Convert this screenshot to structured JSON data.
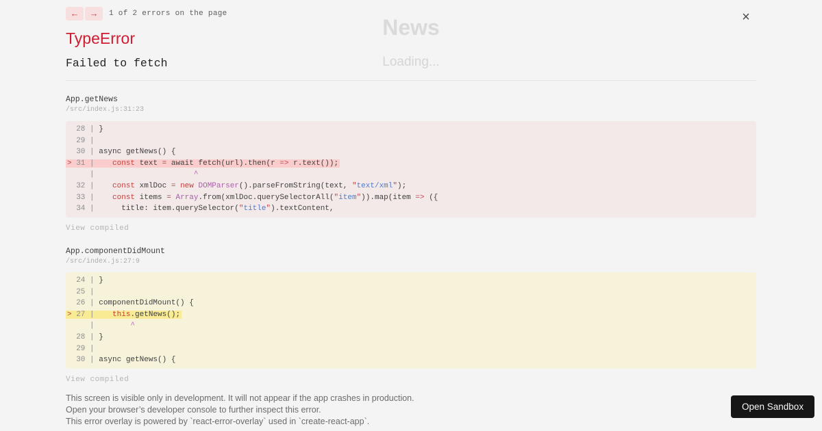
{
  "app_background": {
    "title": "News",
    "loading_text": "Loading..."
  },
  "nav": {
    "back_icon": "←",
    "forward_icon": "→",
    "counter": "1 of 2 errors on the page",
    "close_icon": "×"
  },
  "error": {
    "type": "TypeError",
    "message": "Failed to fetch"
  },
  "frames": [
    {
      "function": "App.getNews",
      "location": "/src/index.js:31:23",
      "variant": "error-pink",
      "view_compiled_label": "View compiled",
      "lines": [
        {
          "hl": false,
          "tokens": [
            [
              "g",
              "  28 | "
            ],
            [
              "p",
              "}"
            ]
          ]
        },
        {
          "hl": false,
          "tokens": [
            [
              "g",
              "  29 | "
            ]
          ]
        },
        {
          "hl": false,
          "tokens": [
            [
              "g",
              "  30 | "
            ],
            [
              "p",
              "async getNews() {"
            ]
          ]
        },
        {
          "hl": true,
          "tokens": [
            [
              "m",
              "> "
            ],
            [
              "g",
              "31 | "
            ],
            [
              "p",
              "   "
            ],
            [
              "k",
              "const"
            ],
            [
              "p",
              " text "
            ],
            [
              "o",
              "="
            ],
            [
              "p",
              " await fetch(url).then(r "
            ],
            [
              "a",
              "=>"
            ],
            [
              "p",
              " r.text());"
            ]
          ]
        },
        {
          "hl": false,
          "tokens": [
            [
              "g",
              "     | "
            ],
            [
              "p",
              "                     "
            ],
            [
              "cr",
              "^"
            ]
          ]
        },
        {
          "hl": false,
          "tokens": [
            [
              "g",
              "  32 | "
            ],
            [
              "p",
              "   "
            ],
            [
              "k",
              "const"
            ],
            [
              "p",
              " xmlDoc "
            ],
            [
              "o",
              "="
            ],
            [
              "p",
              " "
            ],
            [
              "k",
              "new"
            ],
            [
              "p",
              " "
            ],
            [
              "c",
              "DOMParser"
            ],
            [
              "p",
              "().parseFromString(text, "
            ],
            [
              "q",
              "\""
            ],
            [
              "s",
              "text/xml"
            ],
            [
              "q",
              "\""
            ],
            [
              "p",
              ");"
            ]
          ]
        },
        {
          "hl": false,
          "tokens": [
            [
              "g",
              "  33 | "
            ],
            [
              "p",
              "   "
            ],
            [
              "k",
              "const"
            ],
            [
              "p",
              " items "
            ],
            [
              "o",
              "="
            ],
            [
              "p",
              " "
            ],
            [
              "c",
              "Array"
            ],
            [
              "p",
              ".from(xmlDoc.querySelectorAll("
            ],
            [
              "q",
              "\""
            ],
            [
              "s",
              "item"
            ],
            [
              "q",
              "\""
            ],
            [
              "p",
              ")).map(item "
            ],
            [
              "a",
              "=>"
            ],
            [
              "p",
              " ({"
            ]
          ]
        },
        {
          "hl": false,
          "tokens": [
            [
              "g",
              "  34 | "
            ],
            [
              "p",
              "     title: item.querySelector("
            ],
            [
              "q",
              "\""
            ],
            [
              "s",
              "title"
            ],
            [
              "q",
              "\""
            ],
            [
              "p",
              ").textContent,"
            ]
          ]
        }
      ]
    },
    {
      "function": "App.componentDidMount",
      "location": "/src/index.js:27:9",
      "variant": "warning-yellow",
      "view_compiled_label": "View compiled",
      "lines": [
        {
          "hl": false,
          "tokens": [
            [
              "g",
              "  24 | "
            ],
            [
              "p",
              "}"
            ]
          ]
        },
        {
          "hl": false,
          "tokens": [
            [
              "g",
              "  25 | "
            ]
          ]
        },
        {
          "hl": false,
          "tokens": [
            [
              "g",
              "  26 | "
            ],
            [
              "p",
              "componentDidMount() {"
            ]
          ]
        },
        {
          "hl": true,
          "tokens": [
            [
              "m",
              "> "
            ],
            [
              "g",
              "27 | "
            ],
            [
              "p",
              "   "
            ],
            [
              "k",
              "this"
            ],
            [
              "p",
              ".getNews();"
            ]
          ]
        },
        {
          "hl": false,
          "tokens": [
            [
              "g",
              "     | "
            ],
            [
              "p",
              "       "
            ],
            [
              "cr",
              "^"
            ]
          ]
        },
        {
          "hl": false,
          "tokens": [
            [
              "g",
              "  28 | "
            ],
            [
              "p",
              "}"
            ]
          ]
        },
        {
          "hl": false,
          "tokens": [
            [
              "g",
              "  29 | "
            ]
          ]
        },
        {
          "hl": false,
          "tokens": [
            [
              "g",
              "  30 | "
            ],
            [
              "p",
              "async getNews() {"
            ]
          ]
        }
      ]
    }
  ],
  "footer": {
    "lines": [
      "This screen is visible only in development. It will not appear if the app crashes in production.",
      "Open your browser’s developer console to further inspect this error.",
      "This error overlay is powered by `react-error-overlay` used in `create-react-app`."
    ],
    "open_sandbox_label": "Open Sandbox"
  },
  "colors": {
    "page_background": "#f5f4f4",
    "error_red": "#d01c30",
    "nav_button_background": "#f8dfdf",
    "nav_arrow_red": "#cf4646",
    "error_block_background": "#f4e9e9",
    "error_block_highlight": "#fbcccc",
    "warning_block_background": "#f7f3db",
    "warning_block_highlight": "#f8eb94",
    "keyword_red": "#c43f3a",
    "class_purple": "#a75fa8",
    "string_blue": "#4d7cc9",
    "sandbox_button_background": "#161616"
  }
}
